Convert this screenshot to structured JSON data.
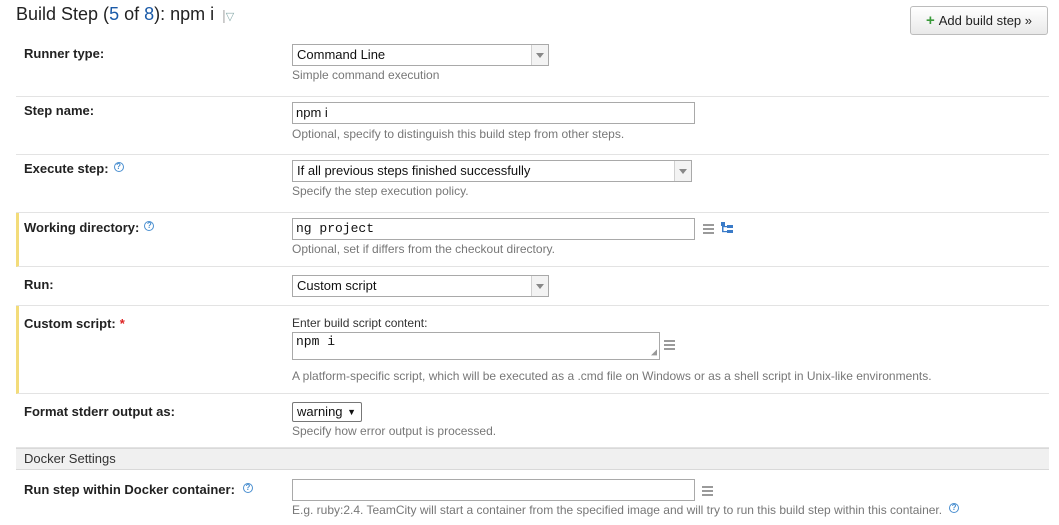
{
  "header": {
    "title_prefix": "Build Step (",
    "step_current": "5",
    "title_of": " of ",
    "step_total": "8",
    "title_suffix": "): npm i",
    "add_button_label": "Add build step »"
  },
  "runner_type": {
    "label": "Runner type:",
    "value": "Command Line",
    "hint": "Simple command execution"
  },
  "step_name": {
    "label": "Step name:",
    "value": "npm i",
    "hint": "Optional, specify to distinguish this build step from other steps."
  },
  "execute_step": {
    "label": "Execute step:",
    "value": "If all previous steps finished successfully",
    "hint": "Specify the step execution policy."
  },
  "working_directory": {
    "label": "Working directory:",
    "value": "ng project",
    "hint": "Optional, set if differs from the checkout directory."
  },
  "run": {
    "label": "Run:",
    "value": "Custom script"
  },
  "custom_script": {
    "label": "Custom script:",
    "required_mark": "*",
    "caption": "Enter build script content:",
    "value": "npm i",
    "hint": "A platform-specific script, which will be executed as a .cmd file on Windows or as a shell script in Unix-like environments."
  },
  "format_stderr": {
    "label": "Format stderr output as:",
    "value": "warning",
    "hint": "Specify how error output is processed."
  },
  "docker_section": {
    "title": "Docker Settings"
  },
  "docker_container": {
    "label": "Run step within Docker container:",
    "value": "",
    "hint": "E.g. ruby:2.4. TeamCity will start a container from the specified image and will try to run this build step within this container."
  },
  "icons": {
    "help": "help-circle-icon",
    "text_editor": "text-editor-icon",
    "directory_tree": "directory-tree-icon",
    "dropdown": "chevron-down-icon",
    "add": "plus-icon"
  },
  "colors": {
    "link_number": "#1a5aa8",
    "required_highlight": "#f3dc7a",
    "help_icon": "#4a8fd0",
    "add_icon": "#3a9a3a",
    "hint_text": "#777777"
  }
}
